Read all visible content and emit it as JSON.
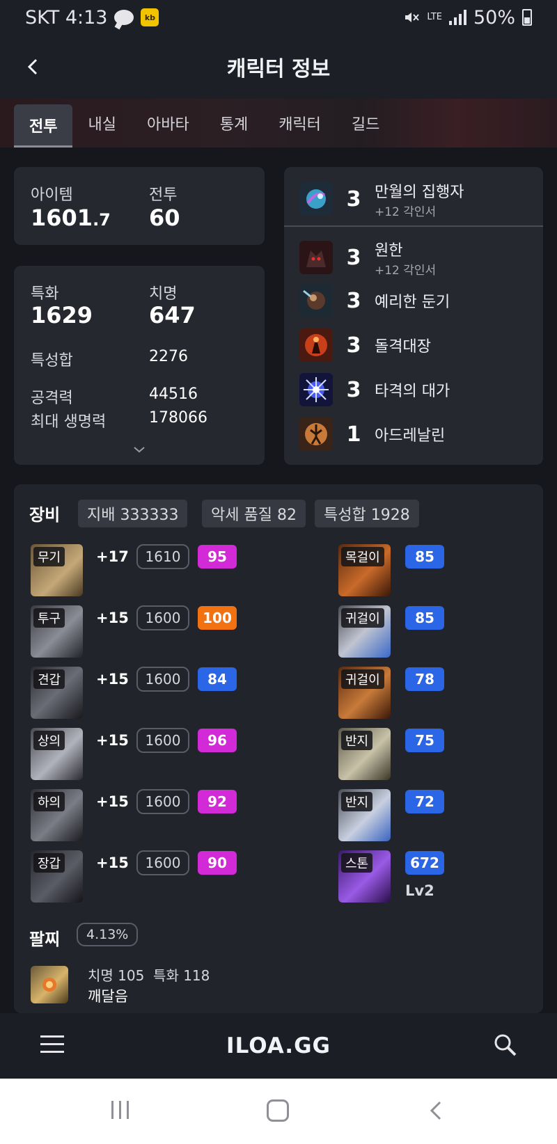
{
  "status_bar": {
    "carrier_time": "SKT 4:13",
    "kakao_badge": "kb",
    "network": "LTE",
    "battery": "50%"
  },
  "header": {
    "title": "캐릭터 정보"
  },
  "tabs": [
    "전투",
    "내실",
    "아바타",
    "통계",
    "캐릭터",
    "길드"
  ],
  "summary": {
    "item_label": "아이템",
    "item_int": "1601",
    "item_dec": ".7",
    "combat_label": "전투",
    "combat_value": "60"
  },
  "stats": {
    "spec_label": "특화",
    "spec_value": "1629",
    "crit_label": "치명",
    "crit_value": "647",
    "total_label": "특성합",
    "total_value": "2276",
    "atk_label": "공격력",
    "atk_value": "44516",
    "hp_label": "최대 생명력",
    "hp_value": "178066"
  },
  "engravings": [
    {
      "level": "3",
      "name": "만월의 집행자",
      "sub": "+12 각인서",
      "icon": "moon-executor-icon"
    },
    {
      "level": "3",
      "name": "원한",
      "sub": "+12 각인서",
      "icon": "grudge-icon"
    },
    {
      "level": "3",
      "name": "예리한 둔기",
      "sub": "",
      "icon": "keen-blunt-icon"
    },
    {
      "level": "3",
      "name": "돌격대장",
      "sub": "",
      "icon": "raid-captain-icon"
    },
    {
      "level": "3",
      "name": "타격의 대가",
      "sub": "",
      "icon": "hit-master-icon"
    },
    {
      "level": "1",
      "name": "아드레날린",
      "sub": "",
      "icon": "adrenaline-icon"
    }
  ],
  "equipment": {
    "title": "장비",
    "chips": [
      "지배 333333",
      "악세 품질 82",
      "특성합 1928"
    ],
    "armor": [
      {
        "tag": "무기",
        "enh": "+17",
        "ilvl": "1610",
        "quality": "95",
        "qcolor": "pink"
      },
      {
        "tag": "투구",
        "enh": "+15",
        "ilvl": "1600",
        "quality": "100",
        "qcolor": "orange"
      },
      {
        "tag": "견갑",
        "enh": "+15",
        "ilvl": "1600",
        "quality": "84",
        "qcolor": "blue"
      },
      {
        "tag": "상의",
        "enh": "+15",
        "ilvl": "1600",
        "quality": "96",
        "qcolor": "pink"
      },
      {
        "tag": "하의",
        "enh": "+15",
        "ilvl": "1600",
        "quality": "92",
        "qcolor": "pink"
      },
      {
        "tag": "장갑",
        "enh": "+15",
        "ilvl": "1600",
        "quality": "90",
        "qcolor": "pink"
      }
    ],
    "accessories": [
      {
        "tag": "목걸이",
        "quality": "85"
      },
      {
        "tag": "귀걸이",
        "quality": "85"
      },
      {
        "tag": "귀걸이",
        "quality": "78"
      },
      {
        "tag": "반지",
        "quality": "75"
      },
      {
        "tag": "반지",
        "quality": "72"
      },
      {
        "tag": "스톤",
        "quality": "672",
        "level": "Lv2"
      }
    ]
  },
  "bracelet": {
    "title": "팔찌",
    "percent": "4.13%",
    "stats": "치명 105  특화 118",
    "effect": "깨달음"
  },
  "bottom_nav": {
    "logo": "ILOA.GG"
  },
  "colors": {
    "pink": "#d22ad6",
    "orange": "#f27212",
    "blue": "#2a66e6"
  }
}
